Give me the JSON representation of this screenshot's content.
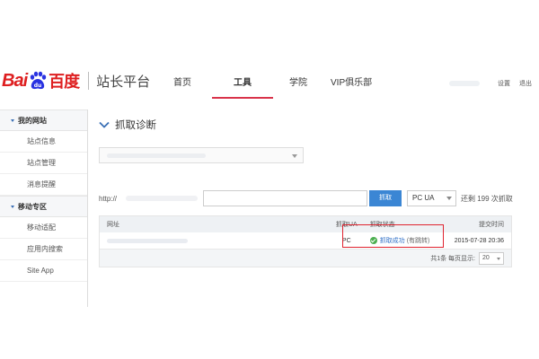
{
  "header": {
    "logo_bai": "Bai",
    "logo_du": "百度",
    "site_title": "站长平台",
    "nav": [
      {
        "label": "首页"
      },
      {
        "label": "工具",
        "active": true
      },
      {
        "label": "学院"
      },
      {
        "label": "VIP俱乐部"
      }
    ],
    "settings_label": "设置",
    "logout_label": "退出"
  },
  "sidebar": {
    "sections": [
      {
        "title": "我的网站",
        "items": [
          "站点信息",
          "站点管理",
          "消息提醒"
        ]
      },
      {
        "title": "移动专区",
        "items": [
          "移动适配",
          "应用内搜索",
          "Site App"
        ]
      }
    ]
  },
  "main": {
    "title": "抓取诊断",
    "fetch": {
      "prefix": "http://",
      "button_label": "抓取",
      "ua_selected": "PC UA",
      "remaining_text": "还剩 199 次抓取"
    },
    "table": {
      "headers": [
        "网址",
        "抓取UA",
        "抓取状态",
        "提交时间"
      ],
      "rows": [
        {
          "ua": "PC",
          "status": "抓取成功",
          "status_note": "(有跳转)",
          "time": "2015-07-28 20:36"
        }
      ],
      "footer": {
        "summary": "共1条 每页显示:",
        "page_size": "20"
      }
    }
  },
  "colors": {
    "brand_red": "#de1f20",
    "brand_blue": "#2932e1",
    "accent_blue": "#3b86d4",
    "highlight_red": "#e0232f",
    "active_tab_underline": "#d9334a",
    "success_green": "#4caf50"
  }
}
